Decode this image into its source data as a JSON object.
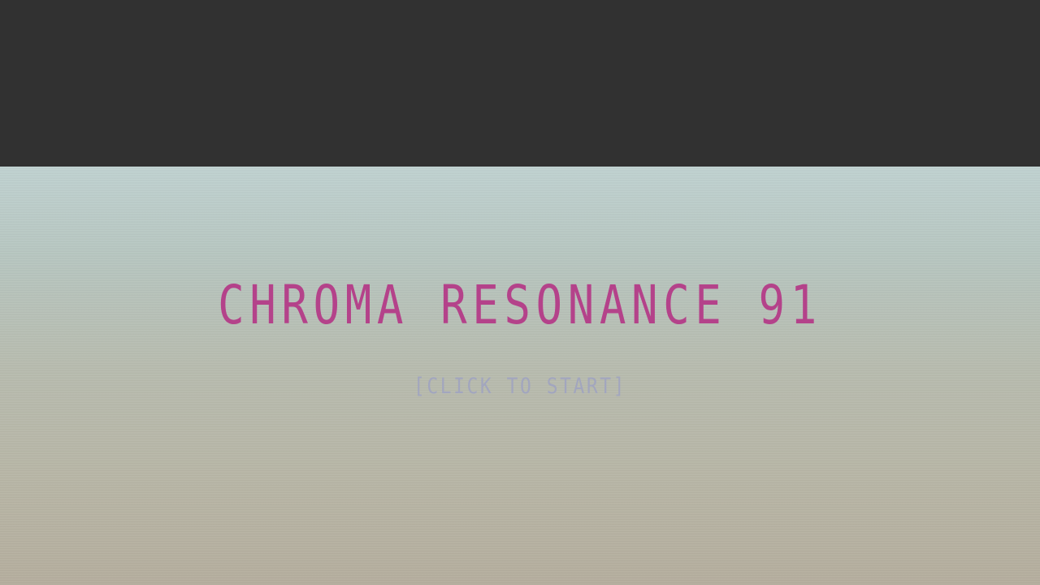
{
  "game": {
    "title": "CHROMA RESONANCE 91",
    "start_prompt": "[CLICK TO START]"
  },
  "colors": {
    "frame_background": "#313131",
    "screen_gradient_top": "#c0d2d1",
    "screen_gradient_bottom": "#b5ae9e",
    "title_color": "#b4428a",
    "prompt_color": "#a2a6be"
  }
}
